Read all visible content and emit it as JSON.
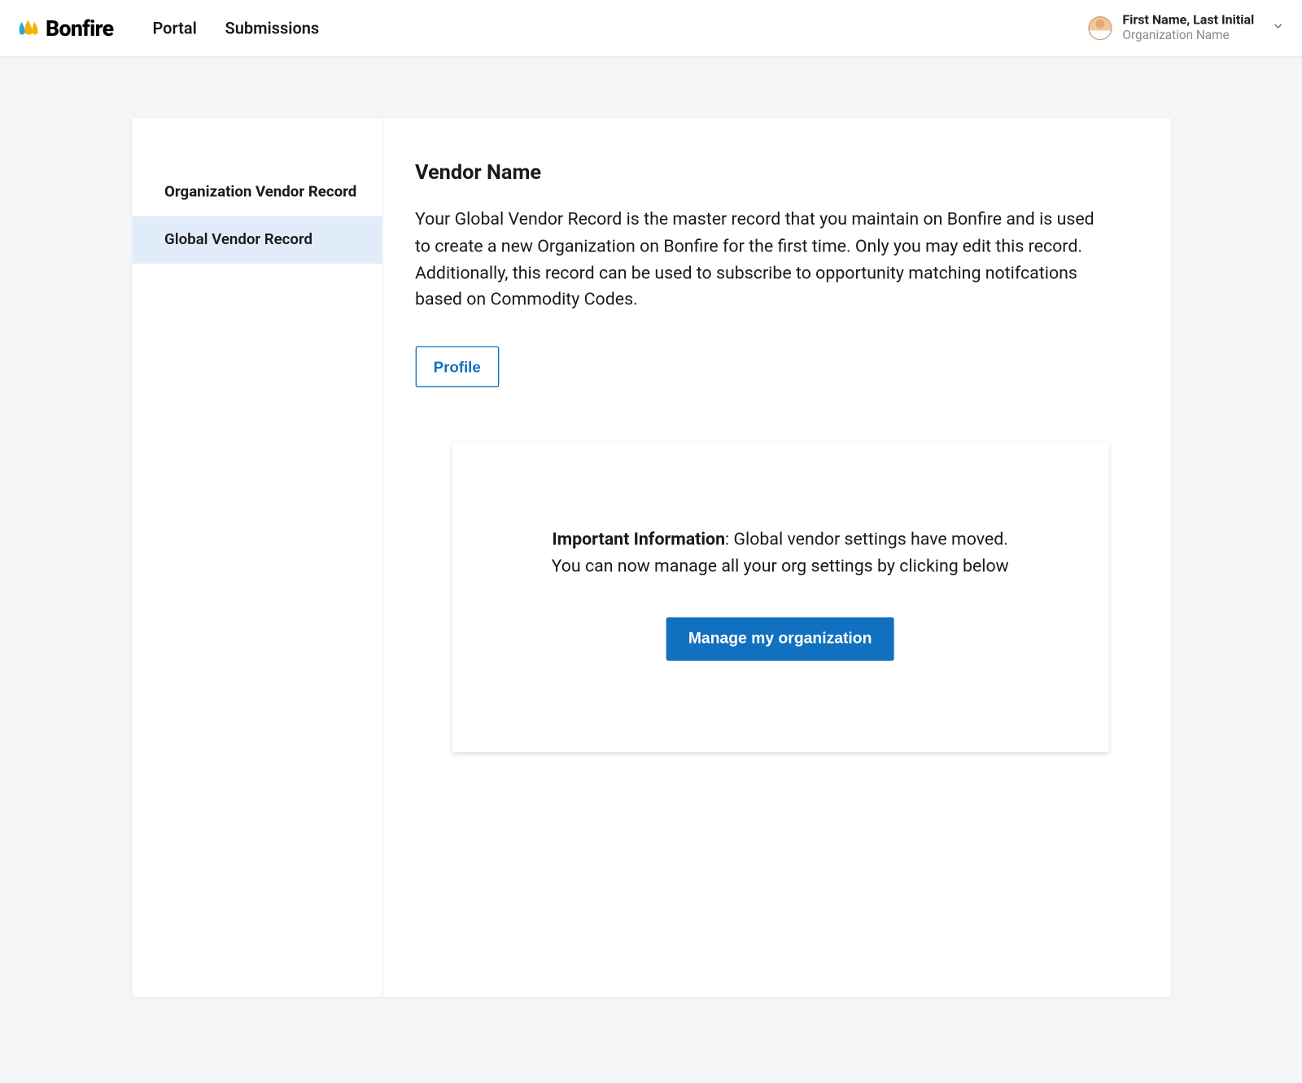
{
  "header": {
    "brand": "Bonfire",
    "nav": {
      "portal": "Portal",
      "submissions": "Submissions"
    },
    "user": {
      "name": "First Name, Last Initial",
      "org": "Organization Name"
    }
  },
  "sidebar": {
    "items": [
      {
        "label": "Organization Vendor Record",
        "active": false
      },
      {
        "label": "Global Vendor Record",
        "active": true
      }
    ]
  },
  "main": {
    "title": "Vendor Name",
    "description": "Your Global Vendor Record is the master record that you maintain on Bonfire and is used to create a new Organization on Bonfire for the first time. Only you may edit this record. Additionally, this record can be used to subscribe to opportunity matching notifcations based on Commodity Codes.",
    "tabs": {
      "profile": "Profile"
    },
    "infoCard": {
      "boldLabel": "Important Information",
      "line1_rest": ": Global vendor settings have moved.",
      "line2": "You can now manage all your org settings by clicking below",
      "buttonLabel": "Manage my organization"
    }
  }
}
